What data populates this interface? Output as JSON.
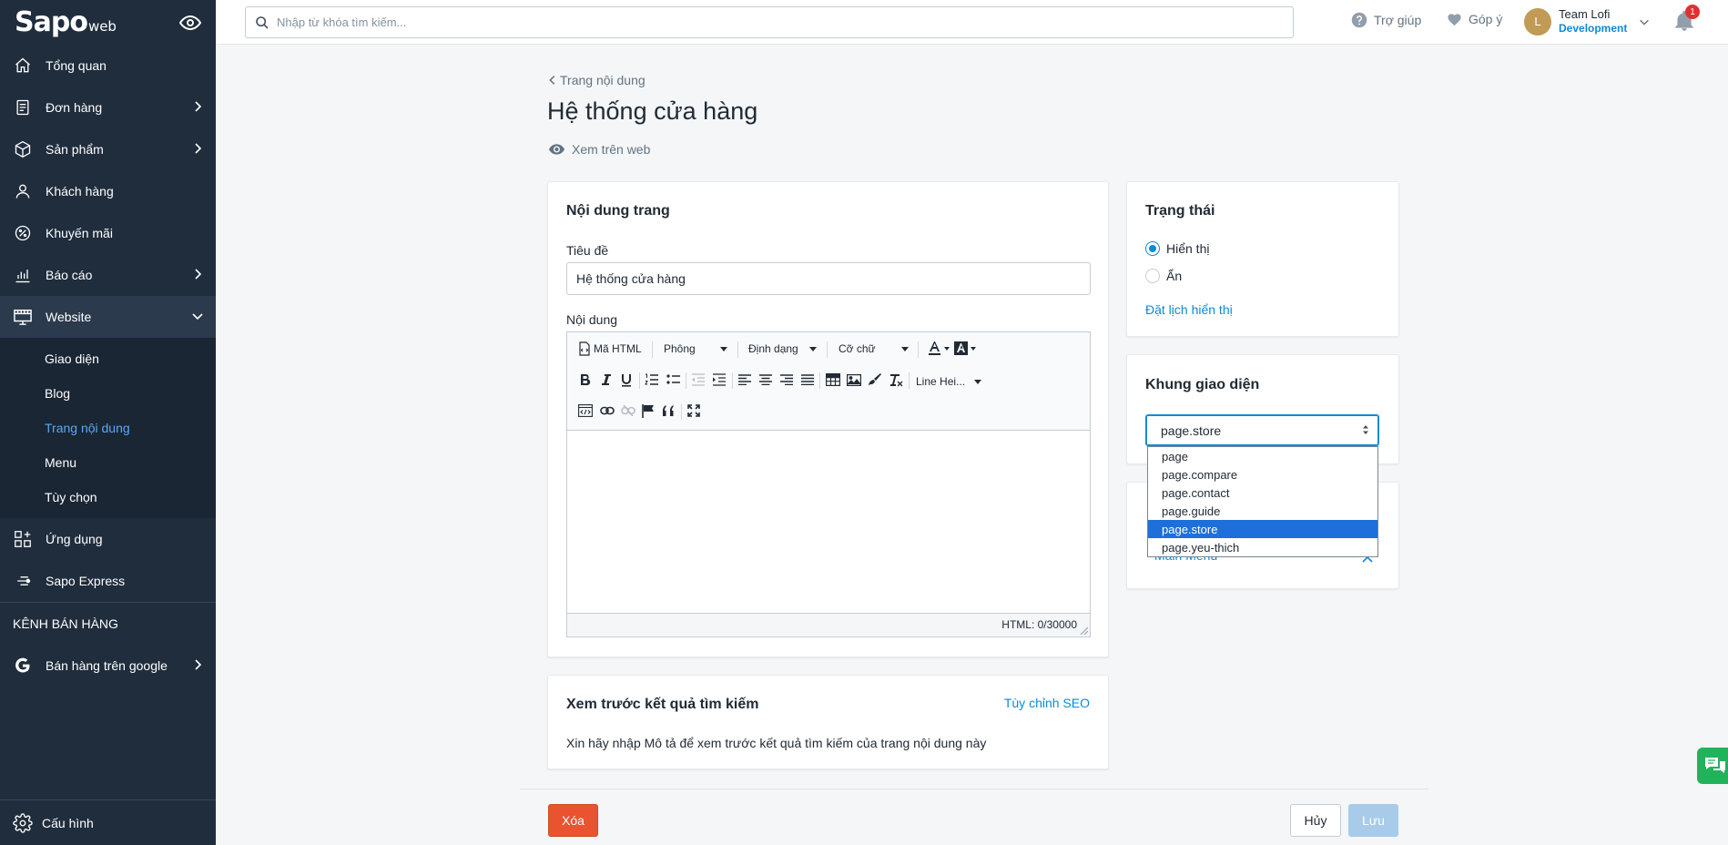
{
  "app": {
    "logo_main": "Sapo",
    "logo_sub": "web"
  },
  "sidebar": {
    "items": [
      {
        "label": "Tổng quan",
        "icon": "home-icon"
      },
      {
        "label": "Đơn hàng",
        "icon": "orders-icon"
      },
      {
        "label": "Sản phẩm",
        "icon": "box-icon"
      },
      {
        "label": "Khách hàng",
        "icon": "user-icon"
      },
      {
        "label": "Khuyến mãi",
        "icon": "percent-icon"
      },
      {
        "label": "Báo cáo",
        "icon": "chart-icon"
      },
      {
        "label": "Website",
        "icon": "store-icon"
      }
    ],
    "website_sub": [
      "Giao diện",
      "Blog",
      "Trang nội dung",
      "Menu",
      "Tùy chọn"
    ],
    "apps": "Ứng dụng",
    "express": "Sapo Express",
    "channels_heading": "KÊNH BÁN HÀNG",
    "google": "Bán hàng trên google",
    "config": "Cấu hình"
  },
  "topbar": {
    "search_placeholder": "Nhập từ khóa tìm kiếm...",
    "help": "Trợ giúp",
    "feedback": "Góp ý",
    "user_initial": "L",
    "user_name": "Team Lofi",
    "user_role": "Development",
    "notif_count": "1"
  },
  "page": {
    "back": "Trang nội dung",
    "title": "Hệ thống cửa hàng",
    "view_web": "Xem trên web"
  },
  "content_card": {
    "heading": "Nội dung trang",
    "title_label": "Tiêu đề",
    "title_value": "Hệ thống cửa hàng",
    "content_label": "Nội dung",
    "toolbar": {
      "html": "Mã HTML",
      "font": "Phông",
      "format": "Định dạng",
      "size": "Cỡ chữ",
      "line_height": "Line Hei..."
    },
    "html_count": "HTML: 0/30000"
  },
  "seo_card": {
    "heading": "Xem trước kết quả tìm kiếm",
    "customize": "Tùy chỉnh SEO",
    "hint": "Xin hãy nhập Mô tả để xem trước kết quả tìm kiếm của trang nội dung này"
  },
  "status_card": {
    "heading": "Trạng thái",
    "visible": "Hiển thị",
    "hidden": "Ẩn",
    "schedule": "Đặt lịch hiển thị"
  },
  "template_card": {
    "heading": "Khung giao diện",
    "selected": "page.store",
    "options": [
      "page",
      "page.compare",
      "page.contact",
      "page.guide",
      "page.store",
      "page.yeu-thich"
    ],
    "selected_index": 4
  },
  "menu_card": {
    "partial_link": "Main Menu"
  },
  "actions": {
    "delete": "Xóa",
    "cancel": "Hủy",
    "save": "Lưu"
  },
  "colors": {
    "sidebar_bg": "#1f2d3d",
    "accent": "#0d8bd6",
    "danger": "#e8542f",
    "save_disabled": "#a8cbe9",
    "dropdown_selected": "#1e6fd9"
  }
}
